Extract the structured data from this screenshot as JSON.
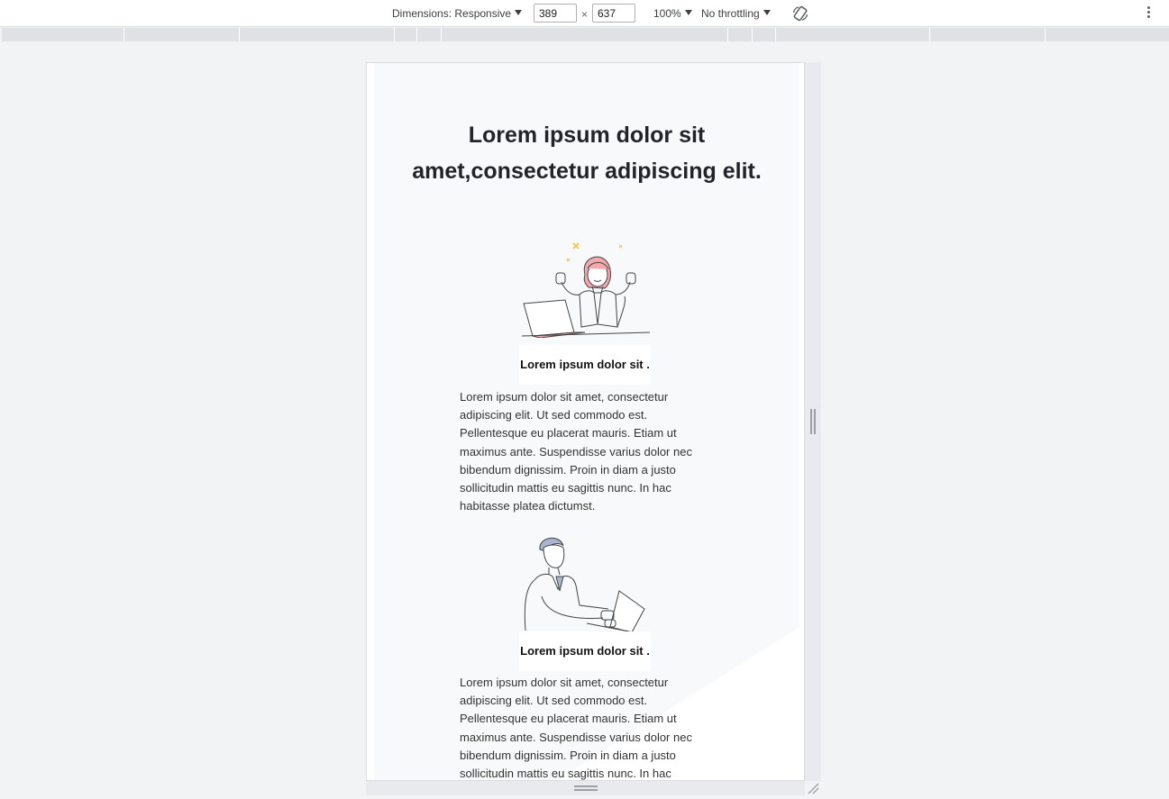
{
  "toolbar": {
    "dimensions_label": "Dimensions: Responsive",
    "width_value": "389",
    "height_value": "637",
    "times_symbol": "×",
    "zoom_label": "100%",
    "throttling_label": "No throttling",
    "rotate_icon": "rotate-icon",
    "more_icon": "kebab-menu-icon"
  },
  "page": {
    "hero_title_line1": "Lorem ipsum dolor sit",
    "hero_title_line2": "amet,consectetur adipiscing elit.",
    "cards": [
      {
        "illustration": "woman-celebrating-at-laptop-illustration",
        "title": "Lorem ipsum dolor sit .",
        "body": "Lorem ipsum dolor sit amet, consectetur adipiscing elit. Ut sed commodo est. Pellentesque eu placerat mauris. Etiam ut maximus ante. Suspendisse varius dolor nec bibendum dignissim. Proin in diam a justo sollicitudin mattis eu sagittis nunc. In hac habitasse platea dictumst."
      },
      {
        "illustration": "man-typing-on-laptop-illustration",
        "title": "Lorem ipsum dolor sit .",
        "body": "Lorem ipsum dolor sit amet, consectetur adipiscing elit. Ut sed commodo est. Pellentesque eu placerat mauris. Etiam ut maximus ante. Suspendisse varius dolor nec bibendum dignissim. Proin in diam a justo sollicitudin mattis eu sagittis nunc. In hac habitasse platea dictumst."
      }
    ]
  },
  "colors": {
    "devtools_background": "#f1f3f4",
    "page_background": "#f8f9fa",
    "accent_pink": "#f2a8ad",
    "accent_blue_gray": "#a9b4d0",
    "sparkle_yellow": "#f5d76e"
  }
}
